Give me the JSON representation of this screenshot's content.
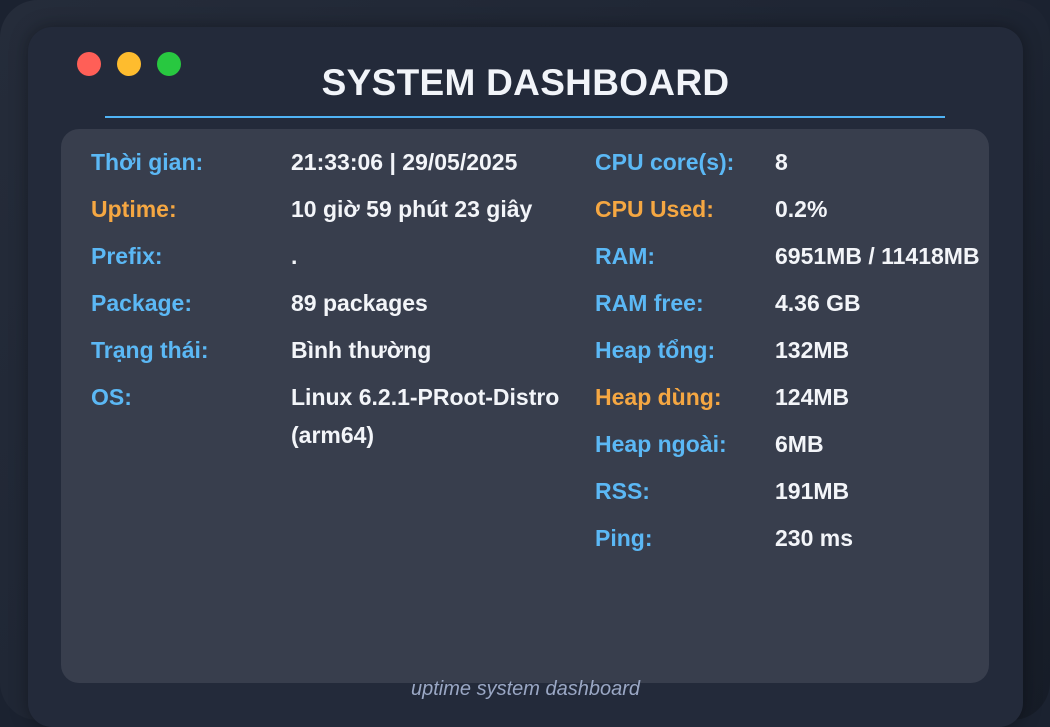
{
  "window": {
    "controls": [
      {
        "name": "close",
        "color": "#ff5f57"
      },
      {
        "name": "minimize",
        "color": "#febc2e"
      },
      {
        "name": "maximize",
        "color": "#28c840"
      }
    ],
    "title": "SYSTEM DASHBOARD",
    "footer": "uptime system dashboard"
  },
  "colors": {
    "label": "#5bb8f5",
    "highlight_label": "#f5a742",
    "value": "#f3f5f9",
    "accent_rule": "#4fb3f5"
  },
  "left": [
    {
      "label": "Thời gian:",
      "value": "21:33:06 | 29/05/2025",
      "highlight": false
    },
    {
      "label": "Uptime:",
      "value": "10 giờ 59 phút 23 giây",
      "highlight": true
    },
    {
      "label": "Prefix:",
      "value": ".",
      "highlight": false
    },
    {
      "label": "Package:",
      "value": "89 packages",
      "highlight": false
    },
    {
      "label": "Trạng thái:",
      "value": "Bình thường",
      "highlight": false
    },
    {
      "label": "OS:",
      "value": "Linux 6.2.1-PRoot-Distro (arm64)",
      "highlight": false
    }
  ],
  "right": [
    {
      "label": "CPU core(s):",
      "value": "8",
      "highlight": false
    },
    {
      "label": "CPU Used:",
      "value": "0.2%",
      "highlight": true
    },
    {
      "label": "RAM:",
      "value": "6951MB / 11418MB",
      "highlight": false
    },
    {
      "label": "RAM free:",
      "value": "4.36 GB",
      "highlight": false
    },
    {
      "label": "Heap tổng:",
      "value": "132MB",
      "highlight": false
    },
    {
      "label": "Heap dùng:",
      "value": "124MB",
      "highlight": true
    },
    {
      "label": "Heap ngoài:",
      "value": "6MB",
      "highlight": false
    },
    {
      "label": "RSS:",
      "value": "191MB",
      "highlight": false
    },
    {
      "label": "Ping:",
      "value": "230 ms",
      "highlight": false
    }
  ]
}
